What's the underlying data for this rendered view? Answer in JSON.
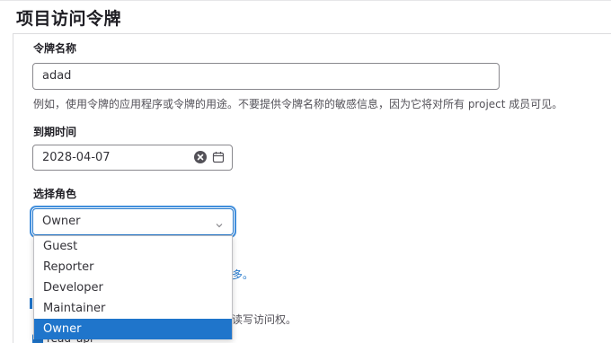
{
  "page": {
    "title": "项目访问令牌"
  },
  "token_name": {
    "label": "令牌名称",
    "value": "adad",
    "help": "例如，使用令牌的应用程序或令牌的用途。不要提供令牌名称的敏感信息，因为它将对所有 project 成员可见。"
  },
  "expiration": {
    "label": "到期时间",
    "value": "2028-04-07",
    "clear_icon": "clear-circle-icon",
    "calendar_icon": "calendar-icon"
  },
  "role": {
    "label": "选择角色",
    "selected": "Owner",
    "options": [
      "Guest",
      "Reporter",
      "Developer",
      "Maintainer",
      "Owner"
    ]
  },
  "partial": {
    "link_fragment": "多。",
    "text_fragment": "读写访问权。",
    "scope_fragment": "read_api"
  },
  "colors": {
    "accent": "#1f75cb",
    "focus_ring": "#428fdc"
  }
}
